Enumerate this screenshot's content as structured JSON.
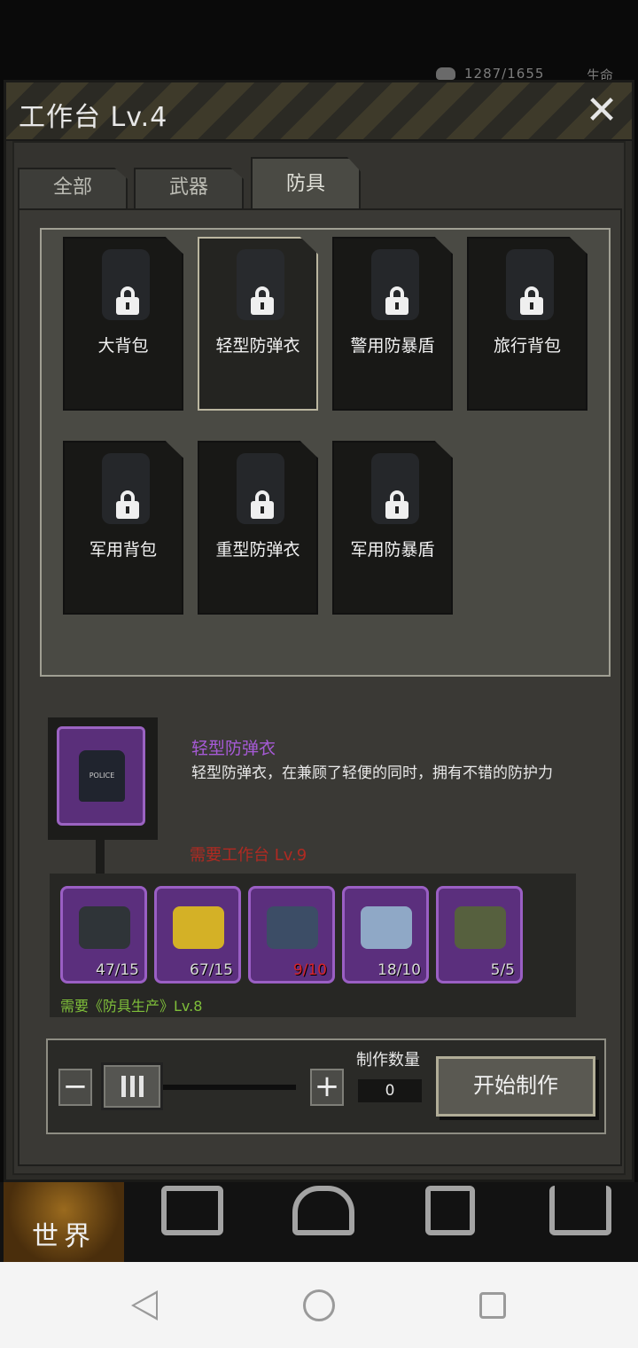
{
  "status": {
    "hp": "1287/1655",
    "hp_label": "生命"
  },
  "header": {
    "title": "工作台 Lv.4",
    "close_icon": "close-icon"
  },
  "tabs": [
    {
      "label": "全部",
      "active": false
    },
    {
      "label": "武器",
      "active": false
    },
    {
      "label": "防具",
      "active": true
    }
  ],
  "items": [
    {
      "label": "大背包",
      "locked": true,
      "selected": false
    },
    {
      "label": "轻型防弹衣",
      "locked": true,
      "selected": true
    },
    {
      "label": "警用防暴盾",
      "locked": true,
      "selected": false
    },
    {
      "label": "旅行背包",
      "locked": true,
      "selected": false
    },
    {
      "label": "军用背包",
      "locked": true,
      "selected": false
    },
    {
      "label": "重型防弹衣",
      "locked": true,
      "selected": false
    },
    {
      "label": "军用防暴盾",
      "locked": true,
      "selected": false
    }
  ],
  "detail": {
    "name": "轻型防弹衣",
    "icon_text": "POLICE",
    "description": "轻型防弹衣，在兼顾了轻便的同时，拥有不错的防护力",
    "requirement": "需要工作台 Lv.9",
    "materials": [
      {
        "count": "47/15",
        "sufficient": true,
        "color": "#2f3438"
      },
      {
        "count": "67/15",
        "sufficient": true,
        "color": "#d4b126"
      },
      {
        "count": "9/10",
        "sufficient": false,
        "color": "#3c4d66"
      },
      {
        "count": "18/10",
        "sufficient": true,
        "color": "#8fa8c6"
      },
      {
        "count": "5/5",
        "sufficient": true,
        "color": "#56603e"
      }
    ],
    "skill_requirement": "需要《防具生产》Lv.8"
  },
  "craft": {
    "minus": "−",
    "plus": "+",
    "quantity_label": "制作数量",
    "quantity": "0",
    "start_label": "开始制作"
  },
  "bottom_nav": {
    "world_label": "世界"
  },
  "colors": {
    "accent_purple": "#5b2f7d",
    "insufficient_red": "#d8232a",
    "skill_green": "#7fbf3a"
  }
}
